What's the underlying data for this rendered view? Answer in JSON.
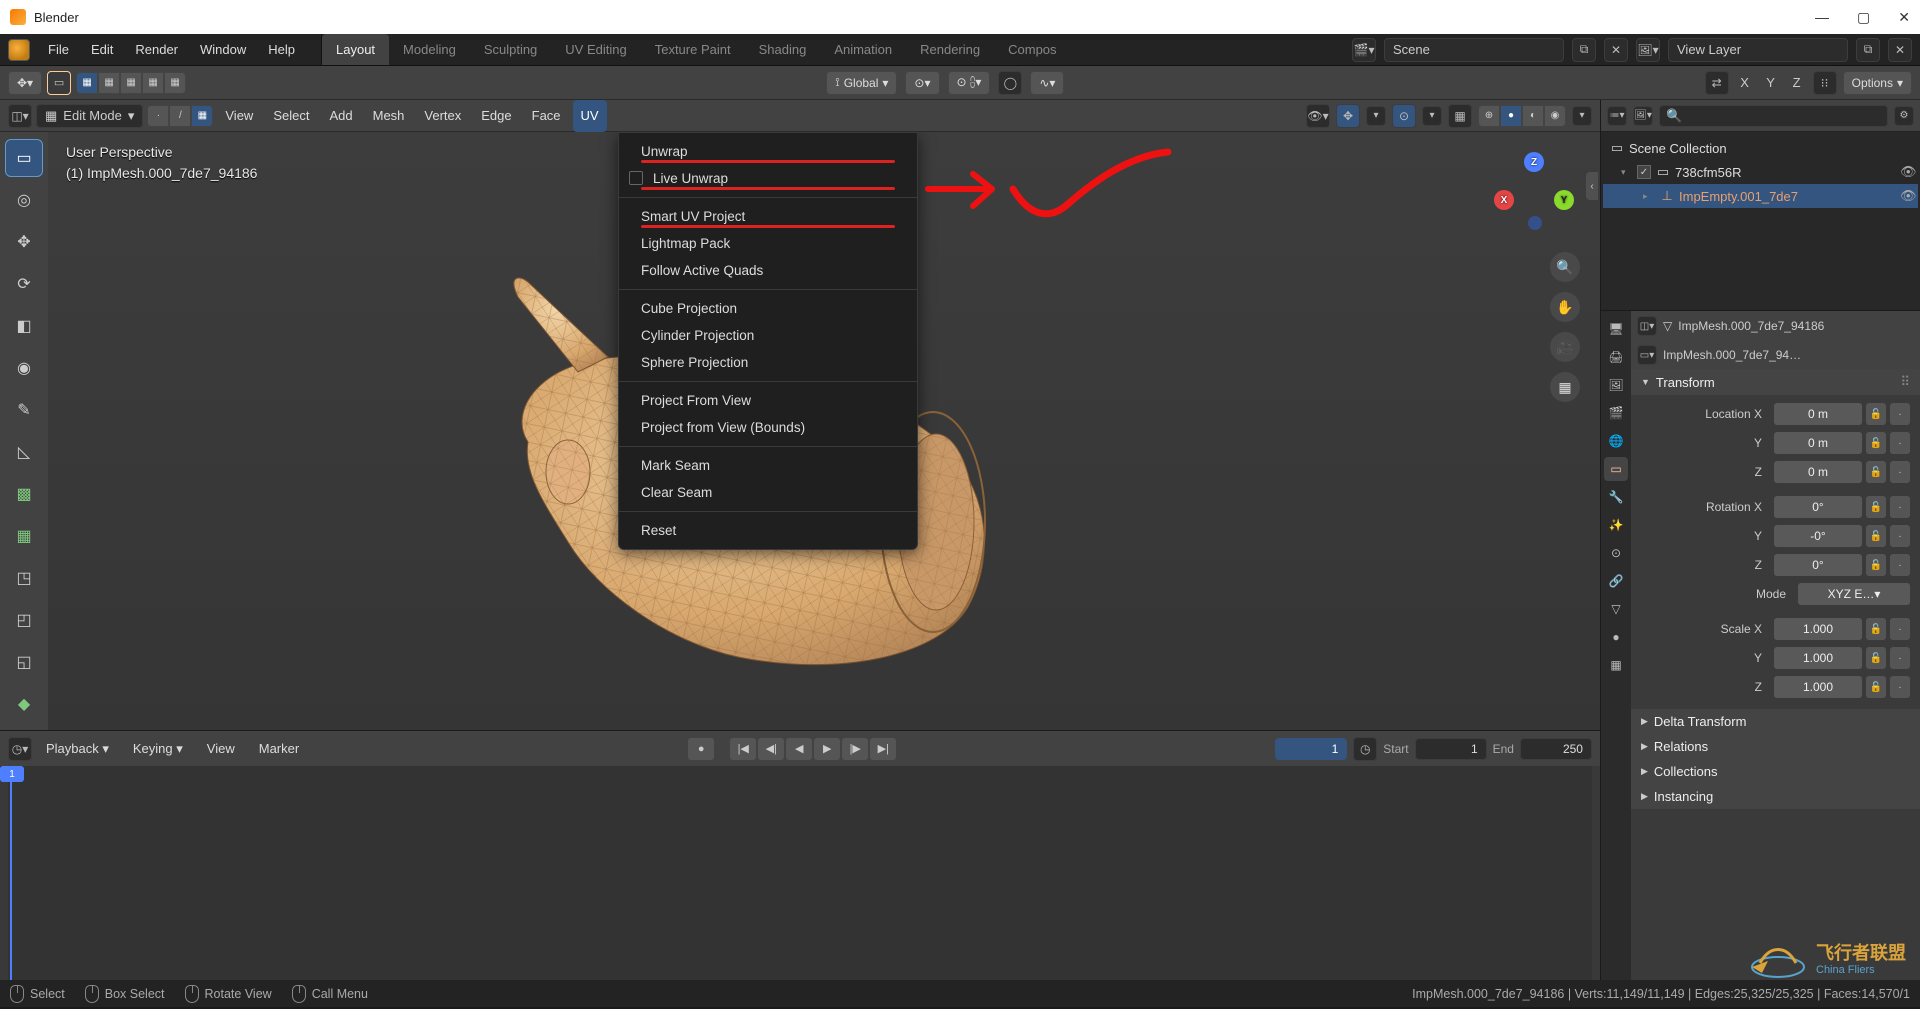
{
  "title": "Blender",
  "window": {
    "min": "—",
    "max": "▢",
    "close": "✕"
  },
  "top_menu": [
    "File",
    "Edit",
    "Render",
    "Window",
    "Help"
  ],
  "workspaces": [
    "Layout",
    "Modeling",
    "Sculpting",
    "UV Editing",
    "Texture Paint",
    "Shading",
    "Animation",
    "Rendering",
    "Compos"
  ],
  "workspace_active": 0,
  "scene": {
    "scene_field": "Scene",
    "viewlayer_field": "View Layer"
  },
  "header2": {
    "orientation": "Global",
    "snap_label": "",
    "options": "Options",
    "axes": [
      "X",
      "Y",
      "Z"
    ]
  },
  "editbar": {
    "mode": "Edit Mode",
    "menus": [
      "View",
      "Select",
      "Add",
      "Mesh",
      "Vertex",
      "Edge",
      "Face",
      "UV"
    ],
    "active_menu": 7
  },
  "viewport": {
    "perspective": "User Perspective",
    "object_line": "(1) ImpMesh.000_7de7_94186"
  },
  "uv_menu": {
    "items": [
      {
        "label": "Unwrap",
        "red": true
      },
      {
        "label": "Live Unwrap",
        "check": true,
        "red": true
      },
      {
        "sep": true
      },
      {
        "label": "Smart UV Project",
        "red": true
      },
      {
        "label": "Lightmap Pack"
      },
      {
        "label": "Follow Active Quads"
      },
      {
        "sep": true
      },
      {
        "label": "Cube Projection"
      },
      {
        "label": "Cylinder Projection"
      },
      {
        "label": "Sphere Projection"
      },
      {
        "sep": true
      },
      {
        "label": "Project From View"
      },
      {
        "label": "Project from View (Bounds)"
      },
      {
        "sep": true
      },
      {
        "label": "Mark Seam"
      },
      {
        "label": "Clear Seam"
      },
      {
        "sep": true
      },
      {
        "label": "Reset"
      }
    ]
  },
  "tools": [
    "▭",
    "◎",
    "✥",
    "⟳",
    "◧",
    "◉",
    "✎",
    "◺",
    "▦",
    "▩",
    "◳",
    "◰",
    "◱",
    "◆"
  ],
  "tool_active": 0,
  "outliner": {
    "collection": "Scene Collection",
    "items": [
      {
        "exp": "▾",
        "cb": true,
        "icon": "▭",
        "label": "738cfm56R",
        "eye": "◉"
      },
      {
        "exp": "▸",
        "cb": false,
        "icon": "⊥",
        "label": "ImpEmpty.001_7de7",
        "eye": "◉",
        "indent": 1,
        "orange": true,
        "sel": true
      }
    ]
  },
  "props": {
    "breadcrumb1": "ImpMesh.000_7de7_94186",
    "breadcrumb2": "ImpMesh.000_7de7_94…",
    "transform": {
      "title": "Transform",
      "loc": {
        "x": "0 m",
        "y": "0 m",
        "z": "0 m"
      },
      "rot": {
        "x": "0°",
        "y": "-0°",
        "z": "0°"
      },
      "mode": "XYZ E…▾",
      "scale": {
        "x": "1.000",
        "y": "1.000",
        "z": "1.000"
      }
    },
    "sections": [
      "Delta Transform",
      "Relations",
      "Collections",
      "Instancing"
    ],
    "labels": {
      "locx": "Location X",
      "roty": "Rotation X",
      "mode": "Mode",
      "scalex": "Scale X",
      "y": "Y",
      "z": "Z"
    }
  },
  "timeline": {
    "menus": [
      "Playback ▾",
      "Keying ▾",
      "View",
      "Marker"
    ],
    "current": "1",
    "start_label": "Start",
    "start": "1",
    "end_label": "End",
    "end": "250"
  },
  "status": {
    "select": "Select",
    "box": "Box Select",
    "rotate": "Rotate View",
    "call": "Call Menu",
    "info": "ImpMesh.000_7de7_94186 | Verts:11,149/11,149 | Edges:25,325/25,325 | Faces:14,570/1"
  },
  "watermark": {
    "cn": "飞行者联盟",
    "en": "China Fliers"
  }
}
